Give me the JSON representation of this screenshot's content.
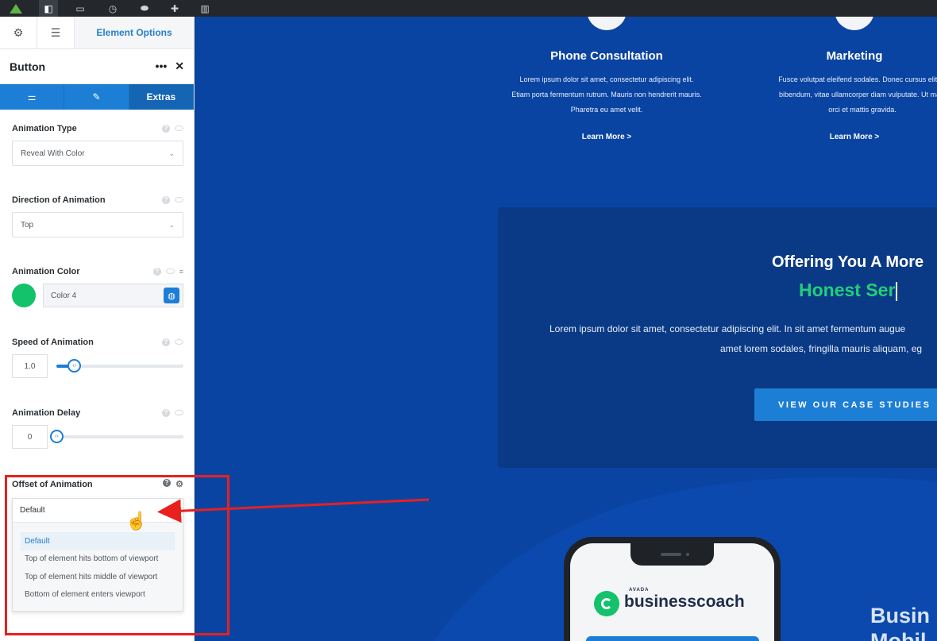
{
  "topbar": {
    "icons": [
      "avada-logo-icon",
      "layout-icon",
      "container-icon",
      "history-icon",
      "toggle-icon",
      "plus-icon",
      "trash-icon"
    ]
  },
  "sidebar": {
    "tab_label": "Element Options",
    "panel_title": "Button",
    "panel_more": "•••",
    "panel_close": "✕",
    "mode_tabs": {
      "extras": "Extras"
    },
    "animation_type": {
      "label": "Animation Type",
      "value": "Reveal With Color"
    },
    "direction": {
      "label": "Direction of Animation",
      "value": "Top"
    },
    "animation_color": {
      "label": "Animation Color",
      "value": "Color 4",
      "swatch": "#13c26b"
    },
    "speed": {
      "label": "Speed of Animation",
      "value": "1.0",
      "fraction": 0.14
    },
    "delay": {
      "label": "Animation Delay",
      "value": "0",
      "fraction": 0.0
    },
    "offset": {
      "label": "Offset of Animation",
      "value": "Default",
      "options": [
        "Default",
        "Top of element hits bottom of viewport",
        "Top of element hits middle of viewport",
        "Bottom of element enters viewport"
      ]
    }
  },
  "preview": {
    "feature1": {
      "title": "Phone Consultation",
      "text": [
        "Lorem ipsum dolor sit amet, consectetur adipiscing elit.",
        "Etiam porta fermentum rutrum. Mauris non hendrerit mauris.",
        "Pharetra eu amet velit."
      ],
      "link": "Learn More >"
    },
    "feature2": {
      "title": "Marketing",
      "text": [
        "Fusce volutpat eleifend sodales. Donec cursus elit vit",
        "bibendum, vitae ullamcorper diam vulputate. Ut male",
        "orci et mattis gravida."
      ],
      "link": "Learn More >"
    },
    "offer": {
      "title": "Offering You A More",
      "subtitle": "Honest Ser",
      "text1": "Lorem ipsum dolor sit amet, consectetur adipiscing elit. In sit amet fermentum augue",
      "text2": "amet lorem sodales, fringilla mauris aliquam, eg",
      "cta": "VIEW OUR CASE STUDIES"
    },
    "phone": {
      "brand_small": "AVADA",
      "brand_name": "businesscoach"
    },
    "heading_partial": [
      "Busin",
      "Mobil"
    ]
  },
  "colors": {
    "accent": "#1d7ed6",
    "green": "#13c26b",
    "background": "#0a44a3",
    "highlight": "#e8201e"
  }
}
